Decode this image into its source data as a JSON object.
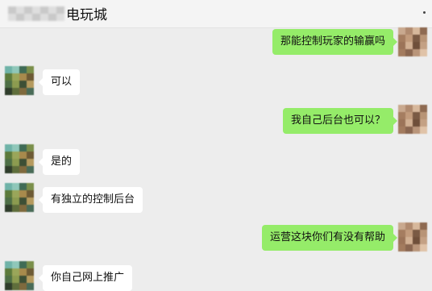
{
  "header": {
    "title": "电玩城",
    "more_icon": "more-dots-icon"
  },
  "messages": [
    {
      "side": "right",
      "text": "那能控制玩家的输赢吗"
    },
    {
      "side": "left",
      "text": "可以"
    },
    {
      "side": "right",
      "text": "我自己后台也可以？"
    },
    {
      "side": "left",
      "text": "是的"
    },
    {
      "side": "left",
      "text": "有独立的控制后台"
    },
    {
      "side": "right",
      "text": "运营这块你们有没有帮助"
    },
    {
      "side": "left",
      "text": "你自己网上推广"
    }
  ],
  "colors": {
    "background": "#ededed",
    "bubble_sent": "#95ec69",
    "bubble_received": "#ffffff"
  }
}
